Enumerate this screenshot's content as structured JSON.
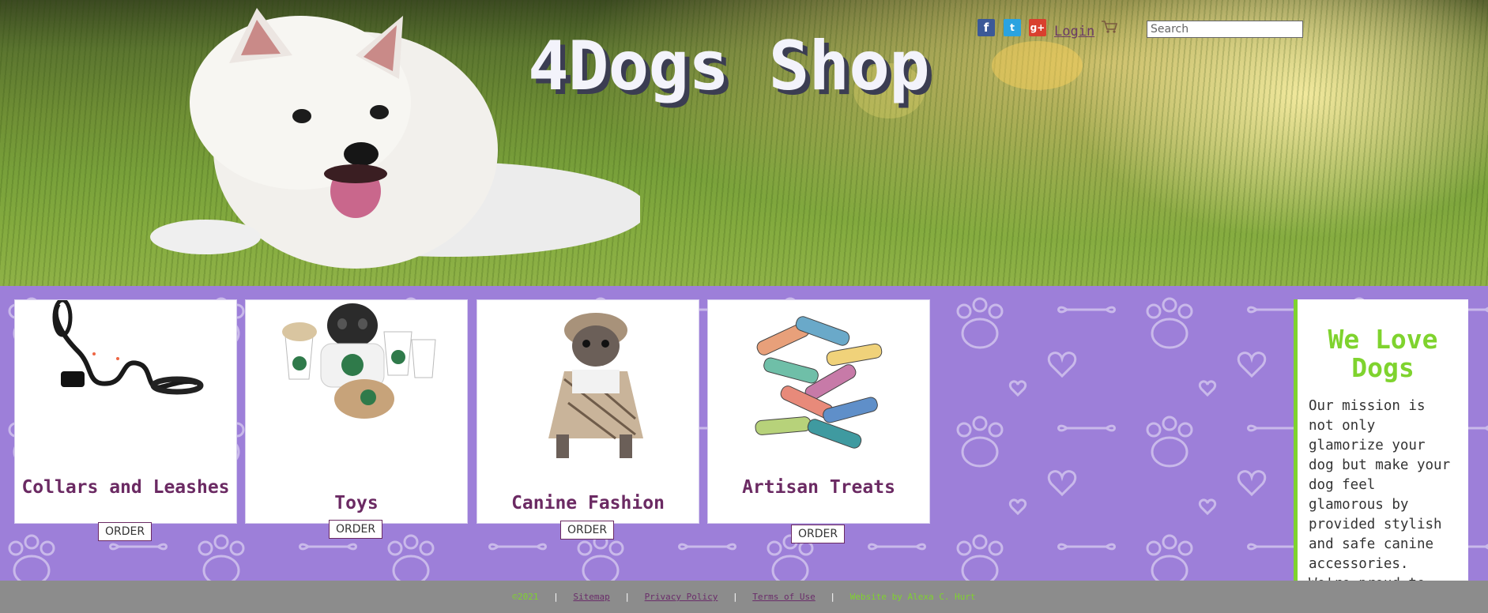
{
  "header": {
    "site_title": "4Dogs Shop",
    "login_label": "Login",
    "search_placeholder": "Search",
    "social_icons": [
      "facebook-icon",
      "twitter-icon",
      "google-plus-icon"
    ],
    "cart_icon": "shopping-cart-icon"
  },
  "products": [
    {
      "title": "Collars and Leashes",
      "order_label": "ORDER",
      "image": "leash-collar-image"
    },
    {
      "title": "Toys",
      "order_label": "ORDER",
      "image": "dog-toys-image"
    },
    {
      "title": "Canine Fashion",
      "order_label": "ORDER",
      "image": "chihuahua-outfit-image"
    },
    {
      "title": "Artisan Treats",
      "order_label": "ORDER",
      "image": "bone-treats-image"
    }
  ],
  "aside": {
    "title": "We Love Dogs",
    "text": "Our mission is not only glamorize your dog but make your dog feel glamorous by provided stylish and safe canine accessories. We're proud to"
  },
  "footer": {
    "copyright": "©2021",
    "sitemap": "Sitemap",
    "privacy": "Privacy Policy",
    "terms": "Terms of Use",
    "credit": "Website by Alexa C. Hurt",
    "separator": "|"
  },
  "colors": {
    "accent_green": "#7fd32e",
    "brand_purple": "#6b2a63",
    "background_purple": "#9d7fd9",
    "footer_gray": "#8c8c8c"
  }
}
